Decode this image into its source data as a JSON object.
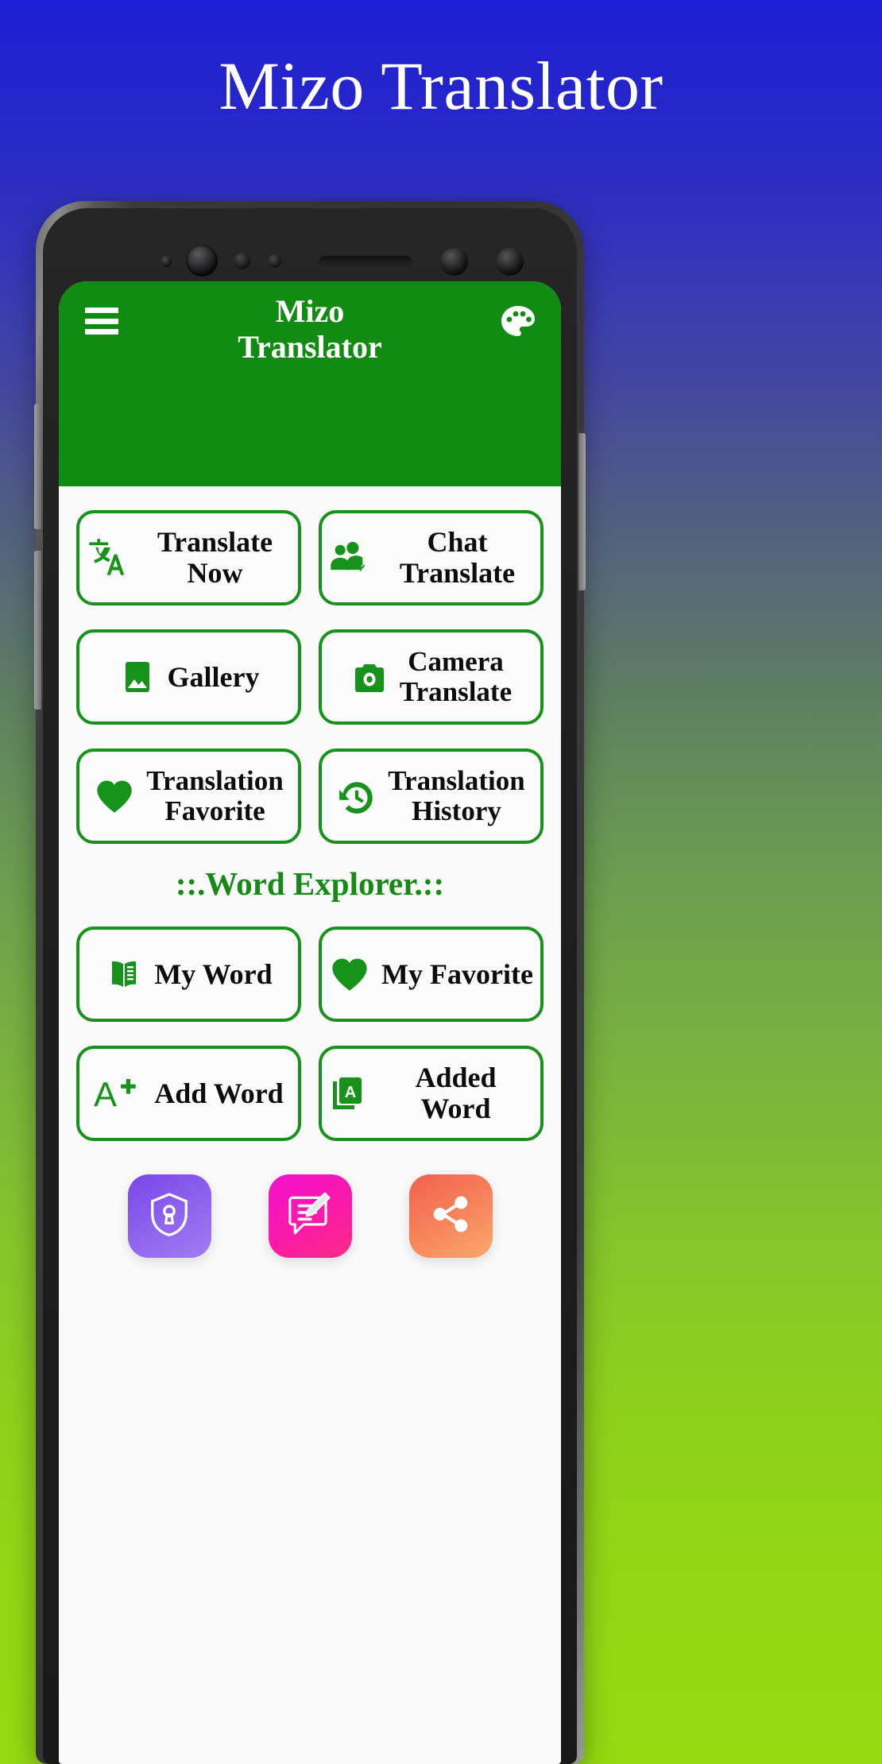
{
  "promo": {
    "title": "Mizo Translator",
    "bg_gradient_from": "#1e1ed4",
    "bg_gradient_to": "#95da11"
  },
  "app": {
    "accent_green": "#128b12",
    "border_green": "#17921a",
    "appbar": {
      "title_line1": "Mizo",
      "title_line2": "Translator",
      "menu_icon": "hamburger-menu-icon",
      "theme_icon": "palette-icon"
    },
    "tiles": [
      {
        "label": "Translate Now",
        "icon": "translate-icon",
        "lines": 1
      },
      {
        "label": "Chat Translate",
        "icon": "chat-translate-icon",
        "lines": 1
      },
      {
        "label": "Gallery",
        "icon": "image-gallery-icon",
        "lines": 1
      },
      {
        "label": "Camera\nTranslate",
        "icon": "camera-icon",
        "lines": 2,
        "line1": "Camera",
        "line2": "Translate"
      },
      {
        "label": "Translation\nFavorite",
        "icon": "heart-icon",
        "lines": 2,
        "line1": "Translation",
        "line2": "Favorite"
      },
      {
        "label": "Translation\nHistory",
        "icon": "history-icon",
        "lines": 2,
        "line1": "Translation",
        "line2": "History"
      }
    ],
    "section_title": "::.Word Explorer.::",
    "word_tiles": [
      {
        "label": "My Word",
        "icon": "open-book-icon",
        "lines": 1
      },
      {
        "label": "My Favorite",
        "icon": "heart-icon",
        "lines": 1
      },
      {
        "label": "Add Word",
        "icon": "a-plus-icon",
        "lines": 1
      },
      {
        "label": "Added Word",
        "icon": "added-cards-icon",
        "lines": 1
      }
    ],
    "bottom_actions": [
      {
        "name": "privacy",
        "icon": "shield-lock-icon",
        "color": "#8d63ee"
      },
      {
        "name": "feedback",
        "icon": "feedback-edit-icon",
        "color": "#fb1aa8"
      },
      {
        "name": "share",
        "icon": "share-icon",
        "color": "#f7865c"
      }
    ]
  }
}
